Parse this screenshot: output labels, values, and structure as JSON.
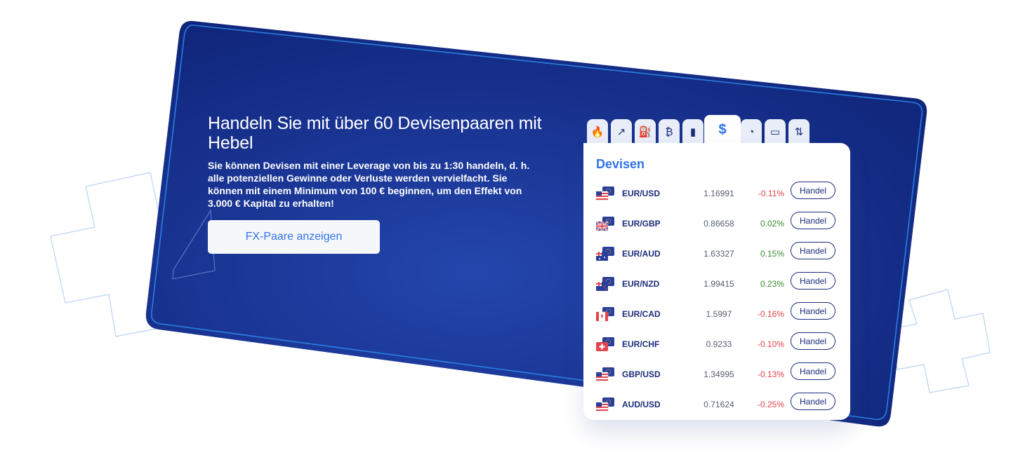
{
  "hero": {
    "title": "Handeln Sie mit über 60 Devisenpaaren mit Hebel",
    "description": "Sie können Devisen mit einer Leverage von bis zu 1:30 handeln, d. h. alle potenziellen Gewinne oder Verluste werden vervielfacht. Sie können mit einem Minimum von 100 € beginnen, um den Effekt von 3.000 € Kapital zu erhalten!",
    "cta_label": "FX-Paare anzeigen"
  },
  "tabs": [
    {
      "name": "popular",
      "icon": "flame-icon",
      "glyph": "🔥",
      "active": false
    },
    {
      "name": "trending",
      "icon": "trending-up-icon",
      "glyph": "↗",
      "active": false
    },
    {
      "name": "commodities",
      "icon": "oil-barrel-icon",
      "glyph": "⛽",
      "active": false
    },
    {
      "name": "crypto",
      "icon": "bitcoin-icon",
      "glyph": "₿",
      "active": false
    },
    {
      "name": "indices",
      "icon": "bar-chart-icon",
      "glyph": "▮",
      "active": false
    },
    {
      "name": "forex",
      "icon": "dollar-icon",
      "glyph": "$",
      "active": true
    },
    {
      "name": "hours",
      "icon": "clock-24-icon",
      "glyph": "◔",
      "active": false
    },
    {
      "name": "stocks",
      "icon": "briefcase-icon",
      "glyph": "▭",
      "active": false
    },
    {
      "name": "etf",
      "icon": "arrows-up-down-icon",
      "glyph": "⇅",
      "active": false
    }
  ],
  "panel": {
    "title": "Devisen",
    "trade_label": "Handel",
    "rows": [
      {
        "pair": "EUR/USD",
        "price": "1.16991",
        "change": "-0.11%",
        "direction": "neg",
        "flag": "us-flag-icon"
      },
      {
        "pair": "EUR/GBP",
        "price": "0.86658",
        "change": "0.02%",
        "direction": "pos",
        "flag": "uk-flag-icon"
      },
      {
        "pair": "EUR/AUD",
        "price": "1.63327",
        "change": "0.15%",
        "direction": "pos",
        "flag": "au-flag-icon"
      },
      {
        "pair": "EUR/NZD",
        "price": "1.99415",
        "change": "0.23%",
        "direction": "pos",
        "flag": "nz-flag-icon"
      },
      {
        "pair": "EUR/CAD",
        "price": "1.5997",
        "change": "-0.16%",
        "direction": "neg",
        "flag": "ca-flag-icon"
      },
      {
        "pair": "EUR/CHF",
        "price": "0.9233",
        "change": "-0.10%",
        "direction": "neg",
        "flag": "ch-flag-icon"
      },
      {
        "pair": "GBP/USD",
        "price": "1.34995",
        "change": "-0.13%",
        "direction": "neg",
        "flag": "us-flag-icon"
      },
      {
        "pair": "AUD/USD",
        "price": "0.71624",
        "change": "-0.25%",
        "direction": "neg",
        "flag": "us-flag-icon"
      }
    ]
  },
  "colors": {
    "banner_dark": "#0f2478",
    "banner_light": "#1f3fa6",
    "accent_blue": "#2f73ea",
    "navy_text": "#1c2c7a",
    "negative": "#e2434c",
    "positive": "#3a8c2c"
  }
}
